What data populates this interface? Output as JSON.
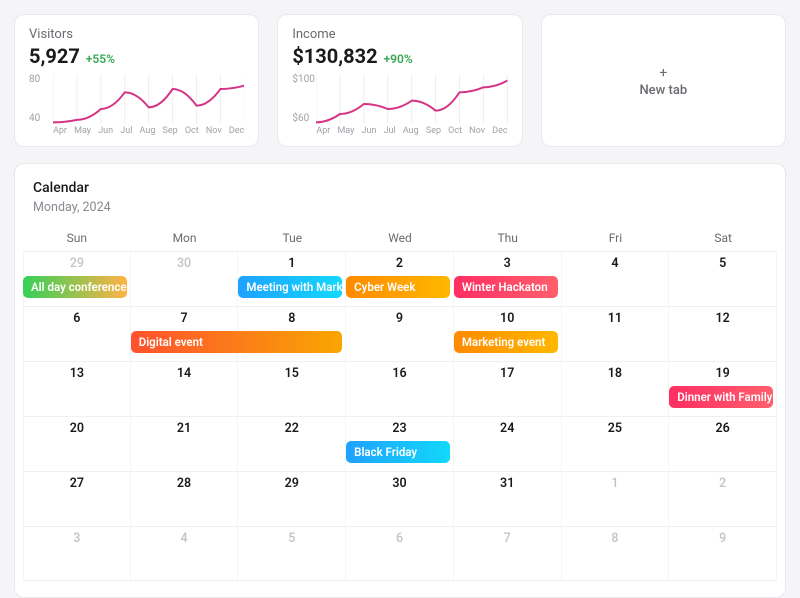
{
  "cards": {
    "visitors": {
      "title": "Visitors",
      "value": "5,927",
      "delta": "+55%"
    },
    "income": {
      "title": "Income",
      "value": "$130,832",
      "delta": "+90%"
    },
    "newtab": {
      "plus": "+",
      "label": "New tab"
    }
  },
  "chart_data": [
    {
      "type": "line",
      "title": "Visitors",
      "x": [
        "Apr",
        "May",
        "Jun",
        "Jul",
        "Aug",
        "Sep",
        "Oct",
        "Nov",
        "Dec"
      ],
      "y": [
        42,
        45,
        58,
        78,
        60,
        82,
        62,
        82,
        86
      ],
      "ylabel": "",
      "xlabel": "",
      "yticks": [
        40,
        80
      ],
      "ylim": [
        40,
        100
      ]
    },
    {
      "type": "line",
      "title": "Income",
      "x": [
        "Apr",
        "May",
        "Jun",
        "Jul",
        "Aug",
        "Sep",
        "Oct",
        "Nov",
        "Dec"
      ],
      "y": [
        62,
        72,
        84,
        78,
        88,
        76,
        98,
        104,
        112
      ],
      "ylabel": "",
      "xlabel": "",
      "yticks": [
        60,
        100
      ],
      "ylim": [
        60,
        120
      ]
    }
  ],
  "calendar": {
    "title": "Calendar",
    "subtitle": "Monday, 2024",
    "dow": [
      "Sun",
      "Mon",
      "Tue",
      "Wed",
      "Thu",
      "Fri",
      "Sat"
    ],
    "weeks": [
      {
        "days": [
          {
            "n": "29",
            "out": true
          },
          {
            "n": "30",
            "out": true
          },
          {
            "n": "1"
          },
          {
            "n": "2"
          },
          {
            "n": "3"
          },
          {
            "n": "4"
          },
          {
            "n": "5"
          }
        ],
        "events": [
          {
            "label": "All day conference",
            "startCol": 0,
            "span": 1,
            "gradient": [
              "#34d058",
              "#ffb347"
            ]
          },
          {
            "label": "Meeting with Mark",
            "startCol": 2,
            "span": 1,
            "gradient": [
              "#1fa2ff",
              "#12d8fa"
            ]
          },
          {
            "label": "Cyber Week",
            "startCol": 3,
            "span": 1,
            "gradient": [
              "#ff8a00",
              "#ffb800"
            ]
          },
          {
            "label": "Winter Hackaton",
            "startCol": 4,
            "span": 1,
            "gradient": [
              "#ff2e63",
              "#ff5f6d"
            ]
          }
        ]
      },
      {
        "days": [
          {
            "n": "6"
          },
          {
            "n": "7"
          },
          {
            "n": "8"
          },
          {
            "n": "9"
          },
          {
            "n": "10"
          },
          {
            "n": "11"
          },
          {
            "n": "12"
          }
        ],
        "events": [
          {
            "label": "Digital event",
            "startCol": 1,
            "span": 2,
            "gradient": [
              "#ff512f",
              "#f9a602"
            ]
          },
          {
            "label": "Marketing event",
            "startCol": 4,
            "span": 1,
            "gradient": [
              "#ff8a00",
              "#ffb800"
            ]
          }
        ]
      },
      {
        "days": [
          {
            "n": "13"
          },
          {
            "n": "14"
          },
          {
            "n": "15"
          },
          {
            "n": "16"
          },
          {
            "n": "17"
          },
          {
            "n": "18"
          },
          {
            "n": "19"
          }
        ],
        "events": [
          {
            "label": "Dinner with Family",
            "startCol": 6,
            "span": 1,
            "gradient": [
              "#ff2e63",
              "#ff5f6d"
            ]
          }
        ]
      },
      {
        "days": [
          {
            "n": "20"
          },
          {
            "n": "21"
          },
          {
            "n": "22"
          },
          {
            "n": "23"
          },
          {
            "n": "24"
          },
          {
            "n": "25"
          },
          {
            "n": "26"
          }
        ],
        "events": [
          {
            "label": "Black Friday",
            "startCol": 3,
            "span": 1,
            "gradient": [
              "#1fa2ff",
              "#12d8fa"
            ]
          }
        ]
      },
      {
        "days": [
          {
            "n": "27"
          },
          {
            "n": "28"
          },
          {
            "n": "29"
          },
          {
            "n": "30"
          },
          {
            "n": "31"
          },
          {
            "n": "1",
            "out": true
          },
          {
            "n": "2",
            "out": true
          }
        ],
        "events": []
      },
      {
        "days": [
          {
            "n": "3",
            "out": true
          },
          {
            "n": "4",
            "out": true
          },
          {
            "n": "5",
            "out": true
          },
          {
            "n": "6",
            "out": true
          },
          {
            "n": "7",
            "out": true
          },
          {
            "n": "8",
            "out": true
          },
          {
            "n": "9",
            "out": true
          }
        ],
        "events": []
      }
    ]
  }
}
